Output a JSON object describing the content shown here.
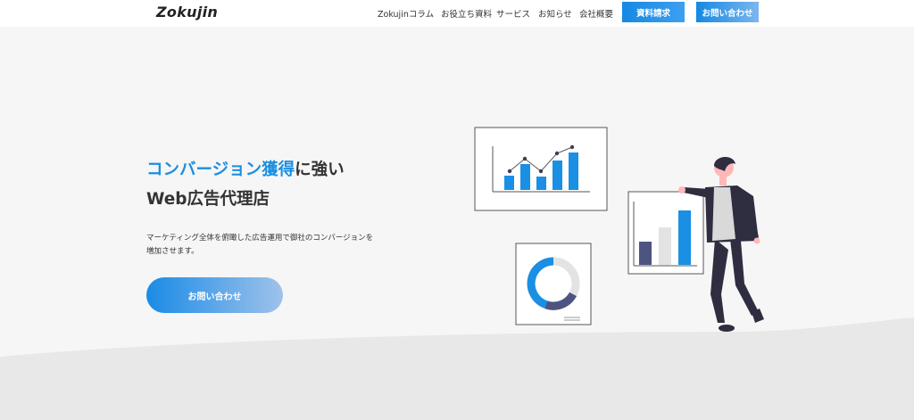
{
  "header": {
    "logo": "Zokujin",
    "nav": [
      "Zokujinコラム",
      "お役立ち資料",
      "サービス",
      "お知らせ",
      "会社概要"
    ],
    "doc_button": "資料請求",
    "contact_button": "お問い合わせ"
  },
  "hero": {
    "headline_accent": "コンバージョン獲得",
    "headline_rest": "に強い",
    "headline_line2": "Web広告代理店",
    "subtext_line1": "マーケティング全体を俯瞰した広告運用で御社のコンバージョンを",
    "subtext_line2": "増加させます。",
    "cta": "お問い合わせ"
  },
  "colors": {
    "accent": "#1a8fe3",
    "dark_bar": "#4e5380",
    "light_bar": "#e3e3e3",
    "figure_dark": "#2f2e41",
    "skin": "#ffb8b8"
  },
  "icons": [
    "line-bar-chart-icon",
    "bar-chart-icon",
    "donut-chart-icon",
    "businessman-figure"
  ]
}
